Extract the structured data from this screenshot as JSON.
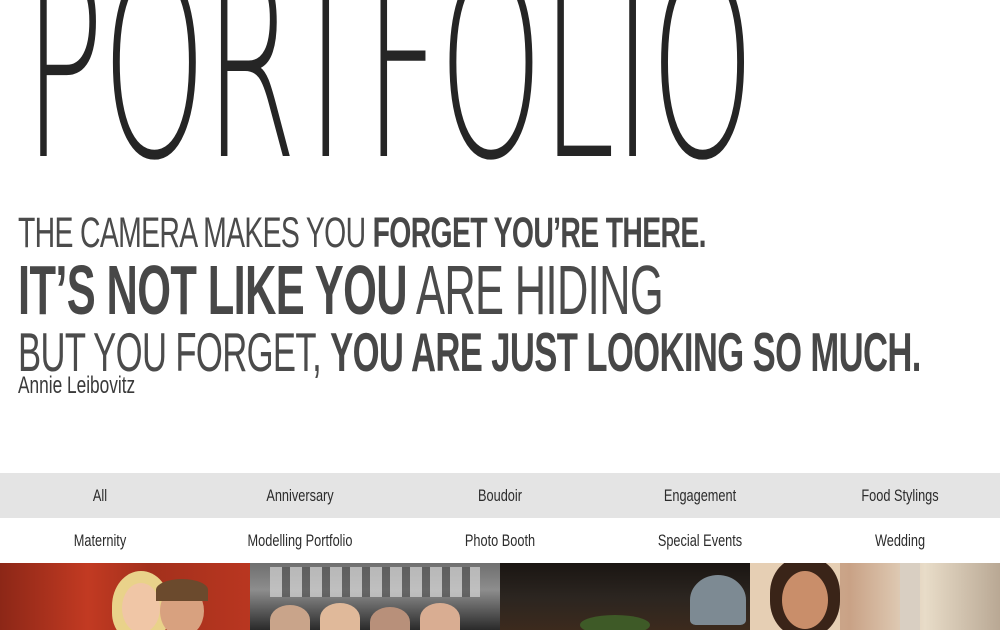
{
  "hero": {
    "title": "PORTFOLIO"
  },
  "quote": {
    "line1_light": "THE CAMERA MAKES YOU ",
    "line1_bold": "FORGET YOU’RE THERE.",
    "line2_bold": "IT’S NOT LIKE YOU",
    "line2_light": " ARE HIDING",
    "line3_light": "BUT YOU FORGET, ",
    "line3_bold": "YOU ARE JUST LOOKING SO MUCH.",
    "author": "Annie Leibovitz"
  },
  "filters": {
    "row1": [
      "All",
      "Anniversary",
      "Boudoir",
      "Engagement",
      "Food Stylings"
    ],
    "row2": [
      "Maternity",
      "Modelling Portfolio",
      "Photo Booth",
      "Special Events",
      "Wedding"
    ]
  },
  "gallery": {
    "thumbnails": [
      "couple-photo",
      "group-photo",
      "food-photo",
      "portrait-photo"
    ]
  },
  "colors": {
    "text": "#2b2b2b",
    "filter_bar": "#e4e4e4",
    "background": "#ffffff"
  }
}
